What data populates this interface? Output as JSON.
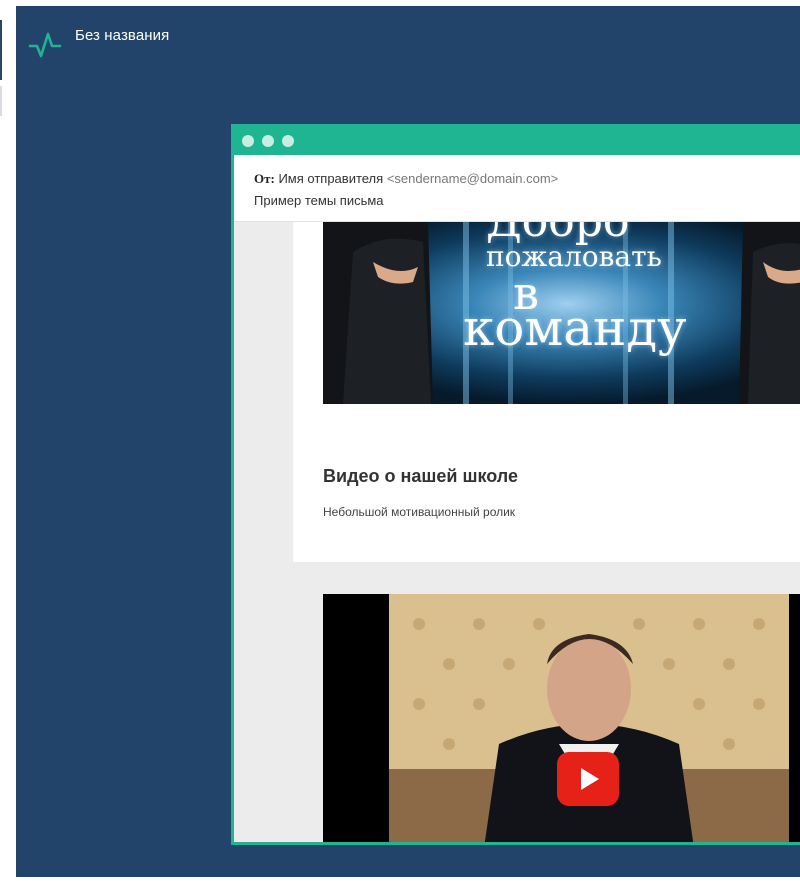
{
  "app": {
    "title": "Без названия",
    "logo_icon": "pulse-icon",
    "background": "#23446a",
    "accent": "#1fb492"
  },
  "email": {
    "from_label": "От:",
    "sender_name": "Имя отправителя",
    "sender_email": "<sendername@domain.com>",
    "subject": "Пример темы письма"
  },
  "banner": {
    "line1": "Добро",
    "line2": "пожаловать",
    "line3": "в",
    "line4": "команду"
  },
  "section": {
    "title": "Видео о нашей школе",
    "subtitle": "Небольшой мотивационный ролик"
  },
  "video": {
    "play_icon": "play-icon",
    "play_color": "#e62117"
  }
}
